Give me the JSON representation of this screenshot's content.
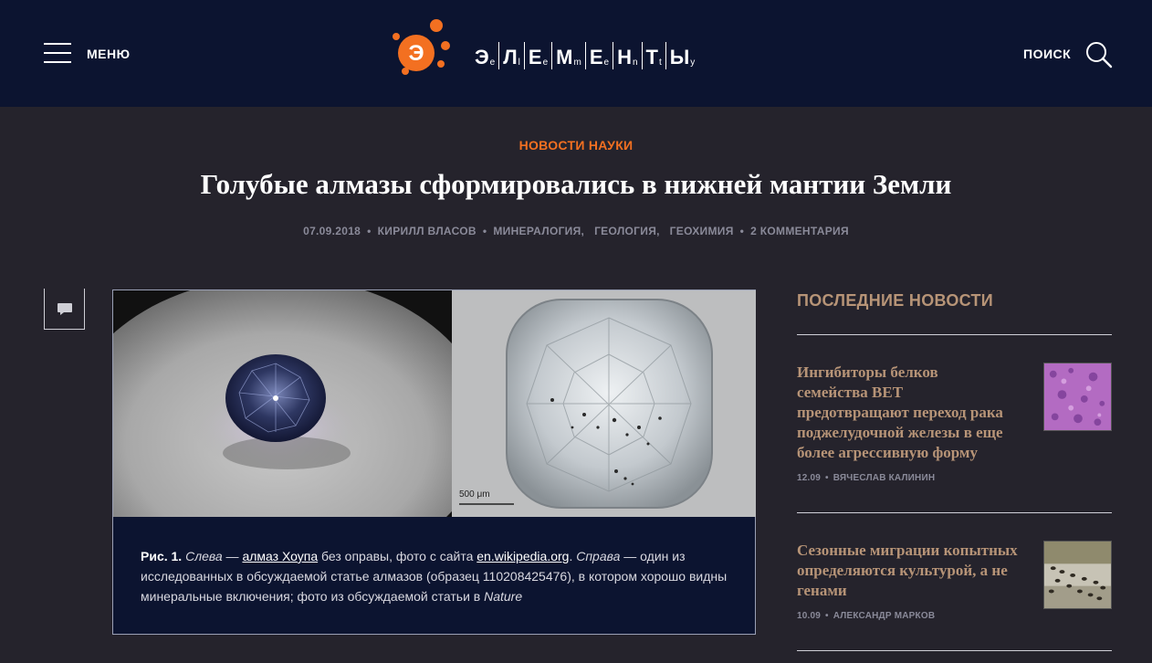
{
  "header": {
    "menu_label": "МЕНЮ",
    "search_label": "ПОИСК",
    "logo": {
      "mark_letter": "Э",
      "letters": [
        {
          "big": "Э",
          "small": "e"
        },
        {
          "big": "Л",
          "small": "l"
        },
        {
          "big": "Е",
          "small": "e"
        },
        {
          "big": "М",
          "small": "m"
        },
        {
          "big": "Е",
          "small": "e"
        },
        {
          "big": "Н",
          "small": "n"
        },
        {
          "big": "Т",
          "small": "t"
        },
        {
          "big": "Ы",
          "small": "y"
        }
      ]
    }
  },
  "article": {
    "category": "НОВОСТИ НАУКИ",
    "title": "Голубые алмазы сформировались в нижней мантии Земли",
    "meta": {
      "date": "07.09.2018",
      "author": "КИРИЛЛ ВЛАСОВ",
      "tags": [
        "МИНЕРАЛОГИЯ,",
        "ГЕОЛОГИЯ,",
        "ГЕОХИМИЯ"
      ],
      "comments": "2 КОММЕНТАРИЯ"
    },
    "figure": {
      "scale_label": "500 μm",
      "caption": {
        "label": "Рис. 1.",
        "left_word": "Слева",
        "dash1": " — ",
        "link1": "алмаз Хоупа",
        "text1": " без оправы, фото с сайта ",
        "link2": "en.wikipedia.org",
        "dot": ". ",
        "right_word": "Справа",
        "text2": " — один из исследованных в обсуждаемой статье алмазов (образец 110208425476), в котором хорошо видны минеральные включения; фото из обсуждаемой статьи в ",
        "journal": "Nature"
      }
    }
  },
  "sidebar": {
    "title": "ПОСЛЕДНИЕ НОВОСТИ",
    "items": [
      {
        "lines": [
          "Ингибиторы белков",
          "семейства BET",
          "предотвращают переход рака",
          "поджелудочной железы в еще",
          "более агрессивную форму"
        ],
        "date": "12.09",
        "author": "ВЯЧЕСЛАВ КАЛИНИН"
      },
      {
        "lines": [
          "Сезонные миграции копытных",
          "определяются культурой, а не",
          "генами"
        ],
        "date": "10.09",
        "author": "АЛЕКСАНДР МАРКОВ"
      }
    ]
  },
  "colors": {
    "header_bg": "#0c1430",
    "page_bg": "#25232c",
    "accent_orange": "#f37021",
    "sidebar_accent": "#b79477"
  }
}
